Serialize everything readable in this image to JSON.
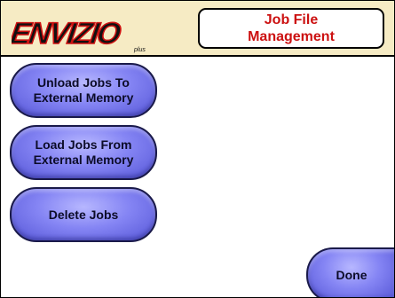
{
  "header": {
    "logo_text": "ENVIZIO",
    "logo_subtext": "plus",
    "title_line1": "Job File",
    "title_line2": "Management"
  },
  "buttons": {
    "unload_line1": "Unload Jobs To",
    "unload_line2": "External Memory",
    "load_line1": "Load Jobs From",
    "load_line2": "External Memory",
    "delete_label": "Delete Jobs",
    "done_label": "Done"
  },
  "colors": {
    "header_bg": "#f6ebc4",
    "title_text": "#cc1111",
    "button_fill": "#8585f4",
    "logo_red": "#cc1111",
    "logo_black": "#111111"
  },
  "icons": {
    "logo": "envizio-plus-logo"
  }
}
